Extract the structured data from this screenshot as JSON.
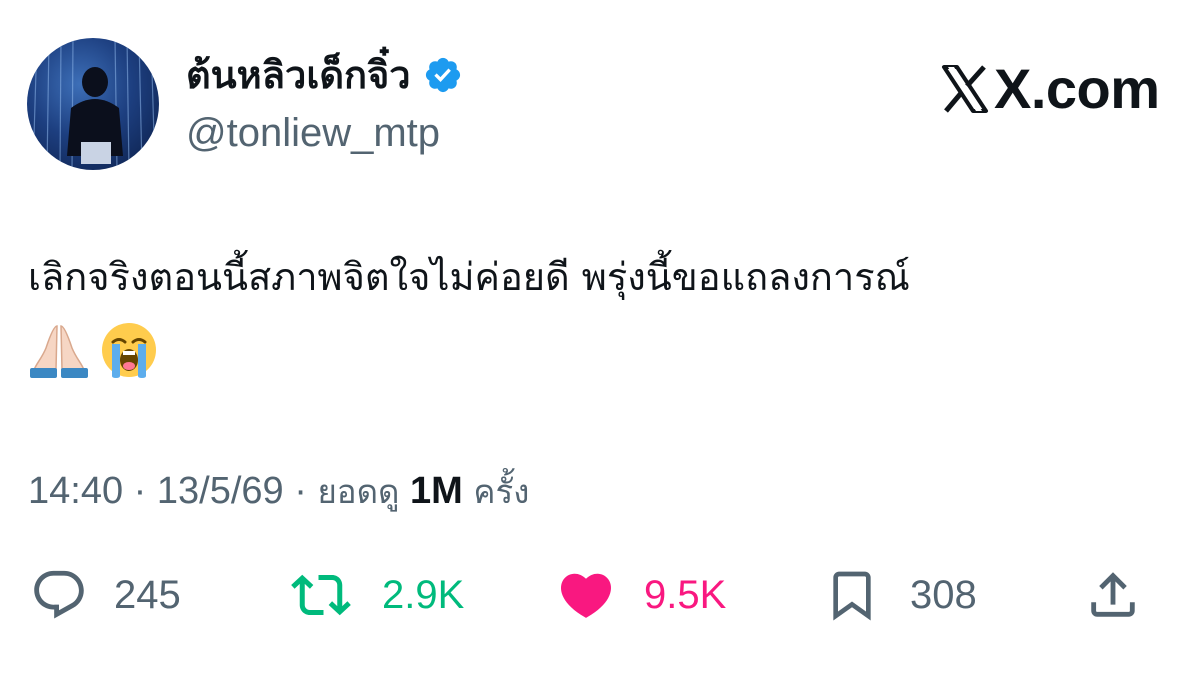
{
  "header": {
    "display_name": "ต้นหลิวเด็กจิ๋ว",
    "handle": "@tonliew_mtp",
    "verified": true,
    "brand": "X.com"
  },
  "tweet": {
    "text": "เลิกจริงตอนนี้สภาพจิตใจไม่ค่อยดี พรุ่งนี้ขอแถลงการณ์",
    "emojis": [
      "folded-hands-emoji",
      "loudly-crying-face-emoji"
    ]
  },
  "meta": {
    "time": "14:40",
    "separator": "·",
    "date": "13/5/69",
    "views_label": "ยอดดู",
    "views_count": "1M",
    "views_suffix": "ครั้ง"
  },
  "actions": {
    "replies": "245",
    "reposts": "2.9K",
    "likes": "9.5K",
    "bookmarks": "308"
  },
  "colors": {
    "text_primary": "#0f1419",
    "text_secondary": "#536471",
    "verified": "#1d9bf0",
    "repost": "#00ba7c",
    "like": "#f91880"
  }
}
